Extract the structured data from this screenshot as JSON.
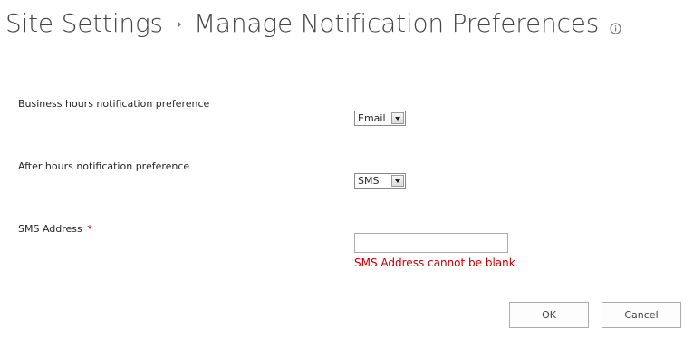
{
  "header": {
    "breadcrumb_root": "Site Settings",
    "page_title": "Manage Notification Preferences",
    "separator_icon": "chevron-right-icon",
    "info_icon": "info-icon"
  },
  "form": {
    "business_hours": {
      "label": "Business hours notification preference",
      "selected": "Email"
    },
    "after_hours": {
      "label": "After hours notification preference",
      "selected": "SMS"
    },
    "sms_address": {
      "label": "SMS Address",
      "required_marker": "*",
      "value": "",
      "error": "SMS Address cannot be blank"
    }
  },
  "buttons": {
    "ok_label": "OK",
    "cancel_label": "Cancel"
  },
  "colors": {
    "text": "#444444",
    "error": "#bf0000",
    "border": "#ababab"
  }
}
